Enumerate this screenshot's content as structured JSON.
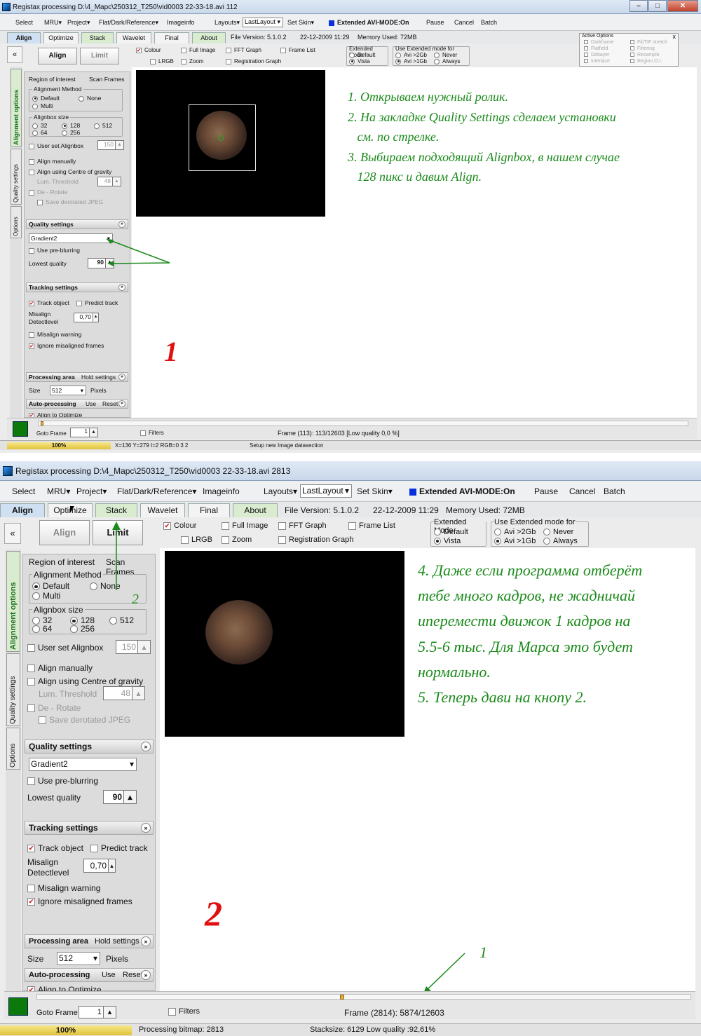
{
  "shot1": {
    "title": "Registax processing D:\\4_Mapc\\250312_T250\\vid0003 22-33-18.avi 112",
    "menu": {
      "select": "Select",
      "mru": "MRU",
      "project": "Project",
      "flat": "Flat/Dark/Reference",
      "imageinfo": "Imageinfo",
      "layouts": "Layouts",
      "lastlayout": "LastLayout",
      "setskin": "Set Skin",
      "avimode": "Extended AVI-MODE:On",
      "pause": "Pause",
      "cancel": "Cancel",
      "batch": "Batch"
    },
    "tabs": {
      "align": "Align",
      "optimize": "Optimize",
      "stack": "Stack",
      "wavelet": "Wavelet",
      "final": "Final",
      "about": "About"
    },
    "info": {
      "file_version": "File Version: 5.1.0.2",
      "date": "22-12-2009 11:29",
      "memory": "Memory Used: 72MB"
    },
    "active_options": {
      "title": "Active Options",
      "left": [
        "Darkframe",
        "Flatfield",
        "Debayer",
        "Interlace"
      ],
      "right": [
        "Fit/TIF stretch",
        "Filtering",
        "Resample",
        "Region.O.I."
      ]
    },
    "buttons": {
      "align": "Align",
      "limit": "Limit"
    },
    "toolbar": {
      "colour": "Colour",
      "lrgb": "LRGB",
      "full_image": "Full Image",
      "zoom": "Zoom",
      "fft_graph": "FFT Graph",
      "registration_graph": "Registration Graph",
      "frame_list": "Frame List"
    },
    "ext_mode": {
      "title": "Extended Mode",
      "default": "Default",
      "vista": "Vista"
    },
    "use_ext": {
      "title": "Use  Extended mode for",
      "avi2": "Avi >2Gb",
      "avi1": "Avi >1Gb",
      "never": "Never",
      "always": "Always"
    },
    "vtabs": {
      "alignment": "Alignment options",
      "quality": "Quality settings",
      "options": "Options"
    },
    "roi": {
      "region": "Region of interest",
      "scan": "Scan Frames"
    },
    "align_method": {
      "title": "Alignment Method",
      "default": "Default",
      "none": "None",
      "multi": "Multi"
    },
    "alignbox": {
      "title": "Alignbox size",
      "s32": "32",
      "s128": "128",
      "s512": "512",
      "s64": "64",
      "s256": "256"
    },
    "user_alignbox": {
      "label": "User set Alignbox",
      "value": "150"
    },
    "align_manually": "Align manually",
    "align_cog": "Align using Centre of gravity",
    "lum": {
      "label": "Lum. Threshold",
      "value": "48"
    },
    "derotate": "De - Rotate",
    "save_derotated": "Save derotated JPEG",
    "quality": {
      "title": "Quality settings",
      "method": "Gradient2",
      "preblur": "Use pre-blurring",
      "lowest": "Lowest quality",
      "value": "90"
    },
    "tracking": {
      "title": "Tracking settings",
      "track": "Track object",
      "predict": "Predict track",
      "misalign": "Misalign",
      "detect": "Detectlevel",
      "detect_value": "0,70",
      "warning": "Misalign warning",
      "ignore": "Ignore misaligned frames"
    },
    "processing": {
      "title": "Processing area",
      "hold": "Hold settings",
      "size": "Size",
      "size_value": "512",
      "pixels": "Pixels"
    },
    "auto": {
      "title": "Auto-processing",
      "use": "Use",
      "reset": "Reset",
      "align_opt": "Align to Optimize"
    },
    "bottom": {
      "goto": "Goto Frame",
      "goto_value": "1",
      "filters": "Filters",
      "frame": "Frame (113): 113/12603 [Low quality 0,0 %]"
    },
    "status": {
      "progress": "100%",
      "coords": "X=136 Y=279 I=2 RGB=0 3 2",
      "msg": "Setup new Image datasection"
    },
    "notes": [
      "1. Открываем нужный ролик.",
      "2. На закладке Quality Settings сделаем установки",
      "   см. по стрелке.",
      "3. Выбираем подходящий Alignbox, в нашем случае",
      "   128 пикс и давим Align."
    ],
    "big_number": "1"
  },
  "shot2": {
    "title": "Registax processing D:\\4_Mapc\\250312_T250\\vid0003 22-33-18.avi 2813",
    "menu": {
      "select": "Select",
      "mru": "MRU",
      "project": "Project",
      "flat": "Flat/Dark/Reference",
      "imageinfo": "Imageinfo",
      "layouts": "Layouts",
      "lastlayout": "LastLayout",
      "setskin": "Set Skin",
      "avimode": "Extended AVI-MODE:On",
      "pause": "Pause",
      "cancel": "Cancel",
      "batch": "Batch"
    },
    "tabs": {
      "align": "Align",
      "optimize": "Optimize",
      "stack": "Stack",
      "wavelet": "Wavelet",
      "final": "Final",
      "about": "About"
    },
    "info": {
      "file_version": "File Version: 5.1.0.2",
      "date": "22-12-2009 11:29",
      "memory": "Memory Used: 72MB"
    },
    "buttons": {
      "align": "Align",
      "limit": "Limit"
    },
    "toolbar": {
      "colour": "Colour",
      "lrgb": "LRGB",
      "full_image": "Full Image",
      "zoom": "Zoom",
      "fft_graph": "FFT Graph",
      "registration_graph": "Registration Graph",
      "frame_list": "Frame List"
    },
    "ext_mode": {
      "title": "Extended Mode",
      "default": "Default",
      "vista": "Vista"
    },
    "use_ext": {
      "title": "Use  Extended mode for",
      "avi2": "Avi >2Gb",
      "avi1": "Avi >1Gb",
      "never": "Never",
      "always": "Always"
    },
    "vtabs": {
      "alignment": "Alignment options",
      "quality": "Quality settings",
      "options": "Options"
    },
    "roi": {
      "region": "Region of interest",
      "scan": "Scan Frames"
    },
    "align_method": {
      "title": "Alignment Method",
      "default": "Default",
      "none": "None",
      "multi": "Multi"
    },
    "alignbox": {
      "title": "Alignbox size",
      "s32": "32",
      "s128": "128",
      "s512": "512",
      "s64": "64",
      "s256": "256"
    },
    "user_alignbox": {
      "label": "User set Alignbox",
      "value": "150"
    },
    "align_manually": "Align manually",
    "align_cog": "Align using Centre of gravity",
    "lum": {
      "label": "Lum. Threshold",
      "value": "48"
    },
    "derotate": "De - Rotate",
    "save_derotated": "Save derotated JPEG",
    "quality": {
      "title": "Quality settings",
      "method": "Gradient2",
      "preblur": "Use pre-blurring",
      "lowest": "Lowest quality",
      "value": "90"
    },
    "tracking": {
      "title": "Tracking settings",
      "track": "Track object",
      "predict": "Predict track",
      "misalign": "Misalign",
      "detect": "Detectlevel",
      "detect_value": "0,70",
      "warning": "Misalign warning",
      "ignore": "Ignore misaligned frames"
    },
    "processing": {
      "title": "Processing area",
      "hold": "Hold settings",
      "size": "Size",
      "size_value": "512",
      "pixels": "Pixels"
    },
    "auto": {
      "title": "Auto-processing",
      "use": "Use",
      "reset": "Reset",
      "align_opt": "Align to Optimize"
    },
    "bottom": {
      "goto": "Goto Frame",
      "goto_value": "1",
      "filters": "Filters",
      "frame": "Frame (2814): 5874/12603"
    },
    "status": {
      "progress": "100%",
      "msg": "Processing bitmap: 2813",
      "stacksize": "Stacksize: 6129 Low quality :92,61%"
    },
    "notes": [
      "4. Даже если программа отберёт",
      "тебе много кадров, не жадничай",
      "иперемести движок 1 кадров на",
      "5.5-6 тыс. Для Марса это будет",
      "нормально.",
      "5. Теперь дави на кнопу 2."
    ],
    "big_number": "2",
    "annot_2": "2",
    "annot_1": "1",
    "slider_position": 0.466
  }
}
